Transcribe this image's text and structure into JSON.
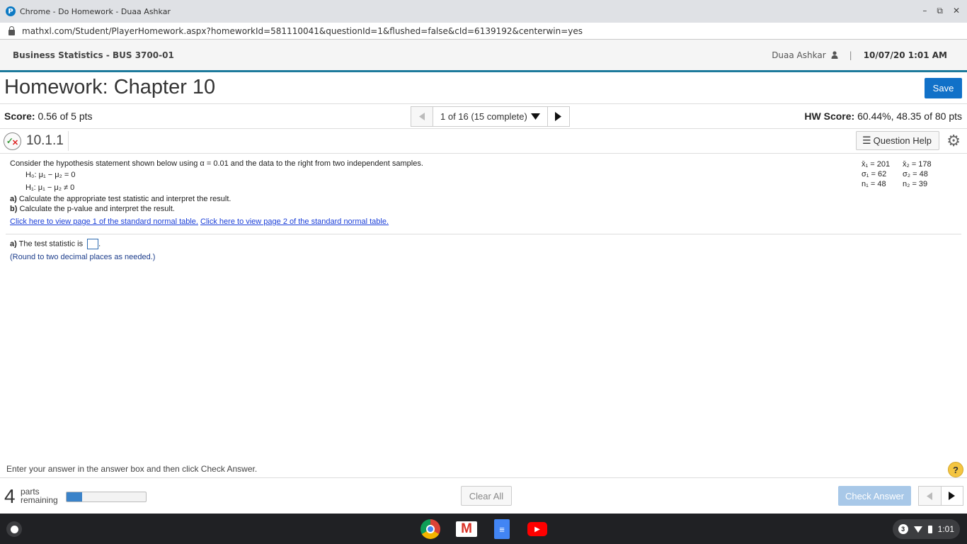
{
  "browser": {
    "window_title": "Chrome - Do Homework - Duaa Ashkar",
    "url": "mathxl.com/Student/PlayerHomework.aspx?homeworkId=581110041&questionId=1&flushed=false&cId=6139192&centerwin=yes",
    "window_controls": {
      "minimize": "–",
      "restore": "⧉",
      "close": "✕"
    }
  },
  "course_bar": {
    "course": "Business Statistics - BUS 3700-01",
    "user": "Duaa Ashkar",
    "separator": "|",
    "datetime": "10/07/20 1:01 AM"
  },
  "homework": {
    "title": "Homework: Chapter 10",
    "save_label": "Save"
  },
  "score_bar": {
    "score_label": "Score:",
    "score_value": " 0.56 of 5 pts",
    "pager_text": "1 of 16 (15 complete)",
    "hw_score_label": "HW Score:",
    "hw_score_value": " 60.44%, 48.35 of 80 pts"
  },
  "question_bar": {
    "number": "10.1.1",
    "help_label": "Question Help"
  },
  "question": {
    "intro": "Consider the hypothesis statement shown below using α = 0.01 and the data to the right from two independent samples.",
    "h0": "H₀: μ₁ − μ₂ = 0",
    "h1": "H₁: μ₁ − μ₂ ≠ 0",
    "part_a_label": "a)",
    "part_a_text": " Calculate the appropriate test statistic and interpret the result.",
    "part_b_label": "b)",
    "part_b_text": " Calculate the p-value and interpret the result.",
    "link1": "Click here to view page 1 of the standard normal table.",
    "link2": "Click here to view page 2 of the standard normal table.",
    "data": {
      "x1": "x̄₁ = 201",
      "x2": "x̄₂ = 178",
      "s1": "σ₁ = 62",
      "s2": "σ₂ = 48",
      "n1": "n₁ = 48",
      "n2": "n₂ = 39"
    }
  },
  "answer": {
    "label": "a)",
    "prompt": " The test statistic is ",
    "value": "",
    "hint": "(Round to two decimal places as needed.)"
  },
  "footer": {
    "instruction": "Enter your answer in the answer box and then click Check Answer.",
    "help_icon": "?",
    "parts_count": "4",
    "parts_line1": "parts",
    "parts_line2": "remaining",
    "progress_fraction": 0.2,
    "clear_all_label": "Clear All",
    "check_answer_label": "Check Answer"
  },
  "taskbar": {
    "apps": [
      "chrome-icon",
      "gmail-icon",
      "docs-icon",
      "youtube-icon"
    ],
    "notification_count": "3",
    "time": "1:01"
  },
  "colors": {
    "accent": "#1171c8",
    "course_bar_border": "#1c7a9c",
    "check_answer_disabled": "#a8c8e8",
    "progress_fill": "#3b83c9"
  }
}
